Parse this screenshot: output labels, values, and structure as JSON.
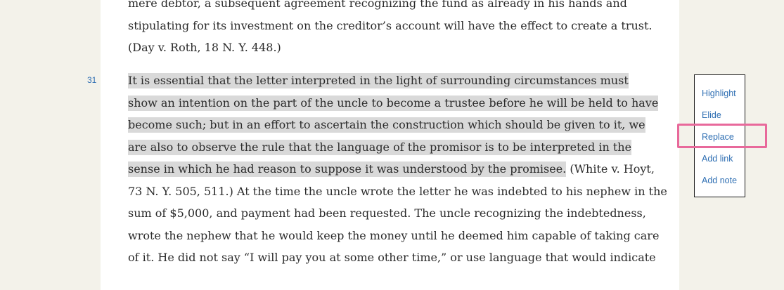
{
  "document": {
    "top_lines": [
      "mere debtor, a subsequent agreement recognizing the fund as already in his hands and",
      "stipulating for its investment on the creditor’s account will have the effect to create a trust.",
      "(Day v. Roth, 18 N. Y. 448.)"
    ],
    "paragraph_31": {
      "number": "31",
      "highlighted_lines": [
        "It is essential that the letter interpreted in the light of surrounding circumstances must",
        "show an intention on the part of the uncle to become a trustee before he will be held to have",
        "become such; but in an effort to ascertain the construction which should be given to it, we",
        "are also to observe the rule that the language of the promisor is to be interpreted in the",
        "sense in which he had reason to suppose it was understood by the promisee."
      ],
      "line5_rest": " (White v. Hoyt,",
      "plain_lines": [
        "73 N. Y. 505, 511.) At the time the uncle wrote the letter he was indebted to his nephew in the",
        "sum of $5,000, and payment had been requested. The uncle recognizing the indebtedness,",
        "wrote the nephew that he would keep the money until he deemed him capable of taking care",
        "of it. He did not say “I will pay you at some other time,” or use language that would indicate"
      ]
    }
  },
  "context_menu": {
    "items": [
      "Highlight",
      "Elide",
      "Replace",
      "Add link",
      "Add note"
    ]
  },
  "colors": {
    "link": "#2f6fb3",
    "highlight": "#d9d9d9",
    "focus": "#e8699b",
    "background": "#f3f2ea"
  }
}
